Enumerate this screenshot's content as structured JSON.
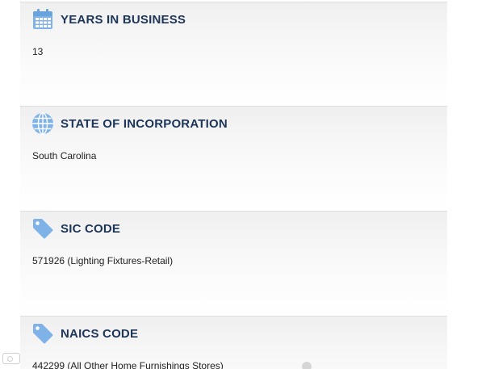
{
  "sections": [
    {
      "title": "YEARS IN BUSINESS",
      "value": "13",
      "icon": "calendar-icon"
    },
    {
      "title": "STATE OF INCORPORATION",
      "value": "South Carolina",
      "icon": "globe-icon"
    },
    {
      "title": "SIC CODE",
      "value": "571926 (Lighting Fixtures-Retail)",
      "icon": "tag-icon"
    },
    {
      "title": "NAICS CODE",
      "value": "442299 (All Other Home Furnishings Stores)",
      "icon": "tag-icon"
    }
  ],
  "colors": {
    "title": "#1d3557",
    "icon": "#7fb3e8",
    "panel_bg": "#f2f2f2"
  }
}
